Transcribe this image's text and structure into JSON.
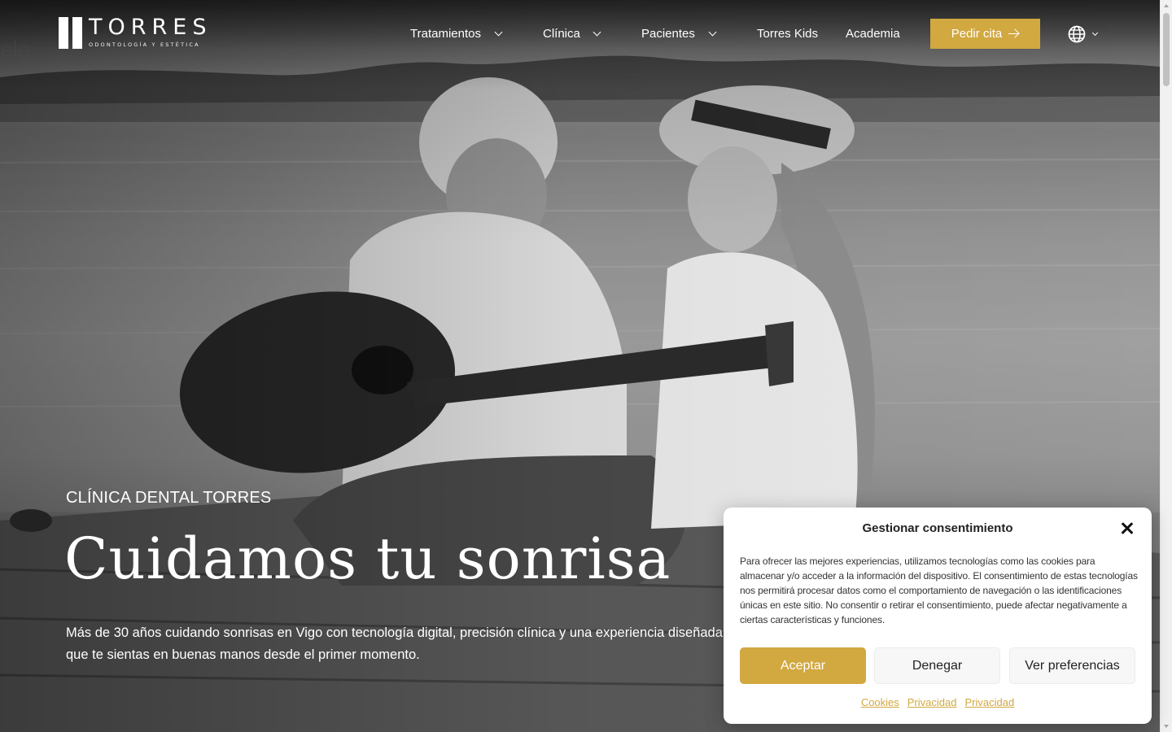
{
  "header": {
    "logo": {
      "name": "TORRES",
      "tagline": "ODONTOLOGÍA Y ESTÉTICA"
    },
    "nav": [
      {
        "label": "Tratamientos",
        "has_dropdown": true
      },
      {
        "label": "Clínica",
        "has_dropdown": true
      },
      {
        "label": "Pacientes",
        "has_dropdown": true
      },
      {
        "label": "Torres Kids",
        "has_dropdown": false
      },
      {
        "label": "Academia",
        "has_dropdown": false
      }
    ],
    "cta_label": "Pedir cita",
    "cta_icon": "arrow-right-icon",
    "language_icon": "globe-icon"
  },
  "hero": {
    "eyebrow": "CLÍNICA DENTAL TORRES",
    "title": "Cuidamos tu sonrisa",
    "subtitle_line1": "Más de 30 años cuidando sonrisas en Vigo con tecnología digital, precisión clínica y una experiencia diseñada para",
    "subtitle_line2": "que te sientas en buenas manos desde el primer momento."
  },
  "consent": {
    "title": "Gestionar consentimiento",
    "body": "Para ofrecer las mejores experiencias, utilizamos tecnologías como las cookies para almacenar y/o acceder a la información del dispositivo. El consentimiento de estas tecnologías nos permitirá procesar datos como el comportamiento de navegación o las identificaciones únicas en este sitio. No consentir o retirar el consentimiento, puede afectar negativamente a ciertas características y funciones.",
    "accept_label": "Aceptar",
    "deny_label": "Denegar",
    "preferences_label": "Ver preferencias",
    "links": [
      "Cookies",
      "Privacidad",
      "Privacidad"
    ]
  },
  "colors": {
    "accent": "#d2a841",
    "text_on_hero": "#ffffff",
    "modal_bg": "#ffffff"
  }
}
